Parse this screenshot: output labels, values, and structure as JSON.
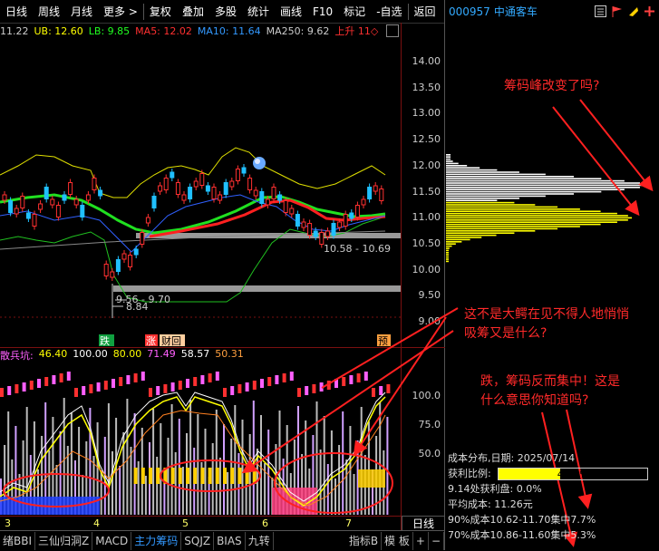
{
  "toolbar": {
    "items": [
      "日线",
      "周线",
      "月线",
      "更多 >",
      "复权",
      "叠加",
      "多股",
      "统计",
      "画线",
      "F10",
      "标记",
      "-自选",
      "返回"
    ]
  },
  "stock": {
    "code": "000957",
    "name": "中通客车"
  },
  "ma": {
    "prefix": "11.22",
    "ub": "UB: 12.60",
    "lb": "LB: 9.85",
    "ma5": "MA5: 12.02",
    "ma10": "MA10: 11.64",
    "ma250": "MA250: 9.62",
    "trend": "上升 11◇"
  },
  "price_axis": [
    "14.00",
    "13.50",
    "13.00",
    "12.50",
    "12.00",
    "11.50",
    "11.00",
    "10.50",
    "10.00",
    "9.50",
    "9.00"
  ],
  "price_annotations": {
    "low_range": "10.58 - 10.69",
    "range2": "9.56 - 9.70",
    "low": "8.84",
    "tag_die": "跌",
    "tag_zhang": "涨",
    "tag_caibao": "财回",
    "tag_yu": "预"
  },
  "indicator": {
    "name": "散兵坑:",
    "values": [
      "46.40",
      "100.00",
      "80.00",
      "71.49",
      "58.57",
      "50.31"
    ],
    "axis": [
      "100.0",
      "75.0",
      "50.0"
    ]
  },
  "dates": [
    "3",
    "4",
    "5",
    "6",
    "7"
  ],
  "period_button": "日线",
  "tabs": [
    "绪BBI",
    "三仙归洞Z",
    "MACD",
    "主力筹码",
    "SQJZ",
    "BIAS",
    "九转",
    "指标B",
    "模 板",
    "+",
    "−"
  ],
  "active_tab": "主力筹码",
  "annotations": {
    "q1": "筹码峰改变了吗?",
    "q2_line1": "这不是大鳄在见不得人地悄悄",
    "q2_line2": "吸筹又是什么?",
    "q3_line1": "跌，筹码反而集中！这是",
    "q3_line2": "什么意思你知道吗?"
  },
  "chip": {
    "title": "成本分布,日期: 2025/07/14",
    "profit_label": "获利比例:",
    "profit_value": "41.6%",
    "profit_pct": 41.6,
    "line3": "9.14处获利盘: 0.0%",
    "line4": "平均成本: 11.26元",
    "line5": "90%成本10.62-11.70集中7.7%",
    "line6": "70%成本10.86-11.60集中5.3%"
  },
  "colors": {
    "up": "#ff3030",
    "down": "#20c0ff",
    "ma5": "#ffffff",
    "ma10": "#ffff00",
    "ma20": "#20ff20",
    "ma60": "#ff30ff",
    "accent": "#3399ff",
    "grid": "#7a1010"
  }
}
